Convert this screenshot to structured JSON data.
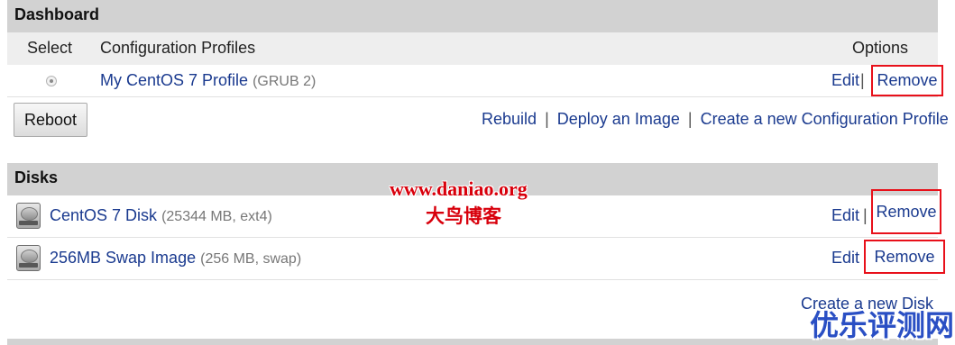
{
  "dashboard": {
    "title": "Dashboard",
    "columns": {
      "select": "Select",
      "profiles": "Configuration Profiles",
      "options": "Options"
    },
    "profile": {
      "name": "My CentOS 7 Profile",
      "kernel": "(GRUB 2)",
      "edit": "Edit",
      "sep": "|",
      "remove": "Remove"
    },
    "reboot_label": "Reboot",
    "actions": {
      "rebuild": "Rebuild",
      "deploy": "Deploy an Image",
      "create_profile": "Create a new Configuration Profile",
      "sep": "|"
    }
  },
  "disks": {
    "title": "Disks",
    "items": [
      {
        "name": "CentOS 7 Disk",
        "meta": "(25344 MB, ext4)",
        "edit": "Edit",
        "sep": "|",
        "remove": "Remove"
      },
      {
        "name": "256MB Swap Image",
        "meta": "(256 MB, swap)",
        "edit": "Edit",
        "remove": "Remove"
      }
    ],
    "create_disk": "Create a new Disk"
  },
  "watermarks": {
    "site_url": "www.daniao.org",
    "site_name": "大鸟博客",
    "corner": "优乐评测网"
  },
  "colors": {
    "link": "#1a3a8f",
    "highlight_box": "#e8101a",
    "header_bg": "#d2d2d2"
  },
  "icons": {
    "disk": "hard-disk-icon",
    "radio": "radio-selected-icon"
  }
}
